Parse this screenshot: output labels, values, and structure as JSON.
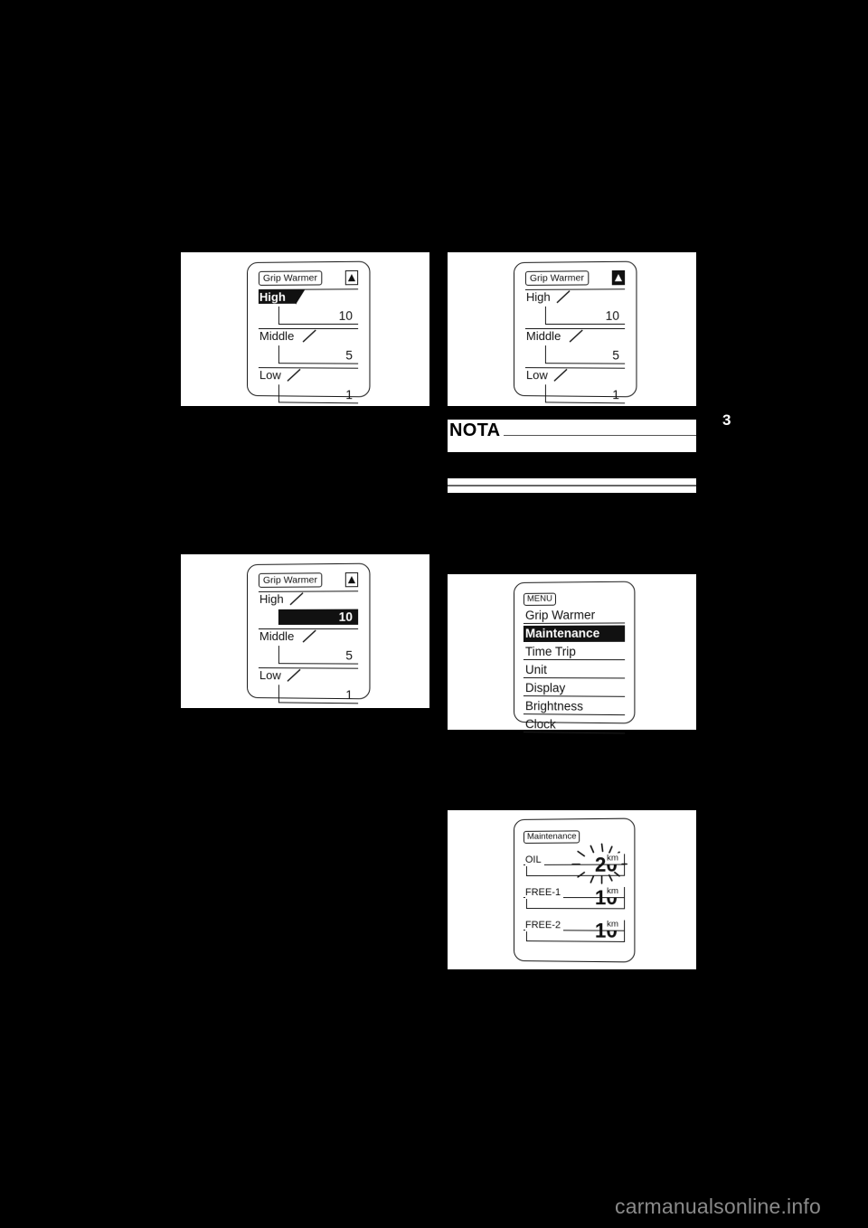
{
  "page": {
    "number": "3",
    "background_color": "#000000",
    "watermark": "carmanualsonline.info"
  },
  "figures": {
    "grip_warmer_high_selected": {
      "title": "Grip Warmer",
      "arrow_icon": "up-arrow-outline-icon",
      "levels": [
        {
          "label": "High",
          "value": "10",
          "label_highlighted": true,
          "value_highlighted": false
        },
        {
          "label": "Middle",
          "value": "5",
          "label_highlighted": false,
          "value_highlighted": false
        },
        {
          "label": "Low",
          "value": "1",
          "label_highlighted": false,
          "value_highlighted": false
        }
      ]
    },
    "grip_warmer_plain": {
      "title": "Grip Warmer",
      "arrow_icon": "up-arrow-filled-icon",
      "levels": [
        {
          "label": "High",
          "value": "10",
          "label_highlighted": false,
          "value_highlighted": false
        },
        {
          "label": "Middle",
          "value": "5",
          "label_highlighted": false,
          "value_highlighted": false
        },
        {
          "label": "Low",
          "value": "1",
          "label_highlighted": false,
          "value_highlighted": false
        }
      ]
    },
    "grip_warmer_value_selected": {
      "title": "Grip Warmer",
      "arrow_icon": "up-arrow-outline-icon",
      "levels": [
        {
          "label": "High",
          "value": "10",
          "label_highlighted": false,
          "value_highlighted": true
        },
        {
          "label": "Middle",
          "value": "5",
          "label_highlighted": false,
          "value_highlighted": false
        },
        {
          "label": "Low",
          "value": "1",
          "label_highlighted": false,
          "value_highlighted": false
        }
      ]
    },
    "menu": {
      "title": "MENU",
      "items": [
        {
          "label": "Grip Warmer",
          "highlighted": false
        },
        {
          "label": "Maintenance",
          "highlighted": true
        },
        {
          "label": "Time Trip",
          "highlighted": false
        },
        {
          "label": "Unit",
          "highlighted": false
        },
        {
          "label": "Display",
          "highlighted": false
        },
        {
          "label": "Brightness",
          "highlighted": false
        },
        {
          "label": "Clock",
          "highlighted": false
        }
      ]
    },
    "maintenance": {
      "title": "Maintenance",
      "rows": [
        {
          "label": "OIL",
          "unit": "km",
          "value": "20",
          "flashing": true
        },
        {
          "label": "FREE-1",
          "unit": "km",
          "value": "10",
          "flashing": false
        },
        {
          "label": "FREE-2",
          "unit": "km",
          "value": "10",
          "flashing": false
        }
      ]
    }
  },
  "note": {
    "heading": "NOTA",
    "body": ""
  }
}
